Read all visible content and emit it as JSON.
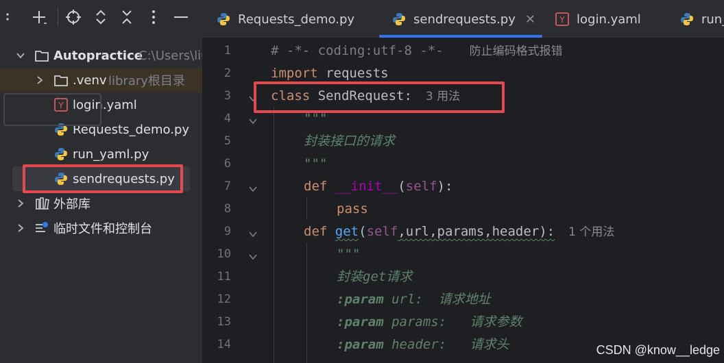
{
  "toolbar": {
    "icons": [
      "plus-icon",
      "locate-icon",
      "expand-icon",
      "collapse-icon",
      "more-icon",
      "hide-icon"
    ]
  },
  "project_tree": {
    "root": {
      "label": "Autopractice",
      "path_hint": "C:\\Users\\liu"
    },
    "venv": {
      "label": ".venv",
      "hint": "library根目录"
    },
    "files": [
      {
        "label": "login.yaml",
        "icon": "yaml-icon"
      },
      {
        "label": "Requests_demo.py",
        "icon": "python-icon"
      },
      {
        "label": "run_yaml.py",
        "icon": "python-icon"
      },
      {
        "label": "sendrequests.py",
        "icon": "python-icon"
      }
    ],
    "external_libs": "外部库",
    "scratches": "临时文件和控制台"
  },
  "tabs": [
    {
      "label": "Requests_demo.py",
      "icon": "python-icon",
      "active": false
    },
    {
      "label": "sendrequests.py",
      "icon": "python-icon",
      "active": true
    },
    {
      "label": "login.yaml",
      "icon": "yaml-icon",
      "active": false
    },
    {
      "label": "run_",
      "icon": "python-icon",
      "active": false
    }
  ],
  "editor": {
    "line_numbers": [
      "1",
      "2",
      "3",
      "4",
      "5",
      "6",
      "7",
      "8",
      "9",
      "10",
      "11",
      "12",
      "13",
      "14"
    ],
    "lines": {
      "l1_code": "# -*- coding:utf-8 -*-",
      "l1_note": "防止编码格式报错",
      "l2_kw": "import",
      "l2_rest": " requests",
      "l3_kw": "class",
      "l3_rest": " SendRequest:",
      "l3_hint": "3 用法",
      "l4": "\"\"\"",
      "l5": "封装接口的请求",
      "l6": "\"\"\"",
      "l7_kw": "def",
      "l7_name": "__init__",
      "l7_open": "(",
      "l7_self": "self",
      "l7_close": "):",
      "l8": "pass",
      "l9_kw": "def",
      "l9_name": "get",
      "l9_open": "(",
      "l9_self": "self",
      "l9_args": ",url,params,header):",
      "l9_hint": "1 个用法",
      "l10": "\"\"\"",
      "l11_a": "封装",
      "l11_b": "get",
      "l11_c": "请求",
      "l12_tag": ":param",
      "l12_name": " url:",
      "l12_desc": "  请求地址",
      "l13_tag": ":param",
      "l13_name": " params:",
      "l13_desc": "   请求参数",
      "l14_tag": ":param",
      "l14_name": " header:",
      "l14_desc": "   请求头"
    }
  },
  "watermark": "CSDN @know__ledge",
  "colors": {
    "highlight_red": "#e5484d",
    "active_tab": "#3574f0"
  }
}
